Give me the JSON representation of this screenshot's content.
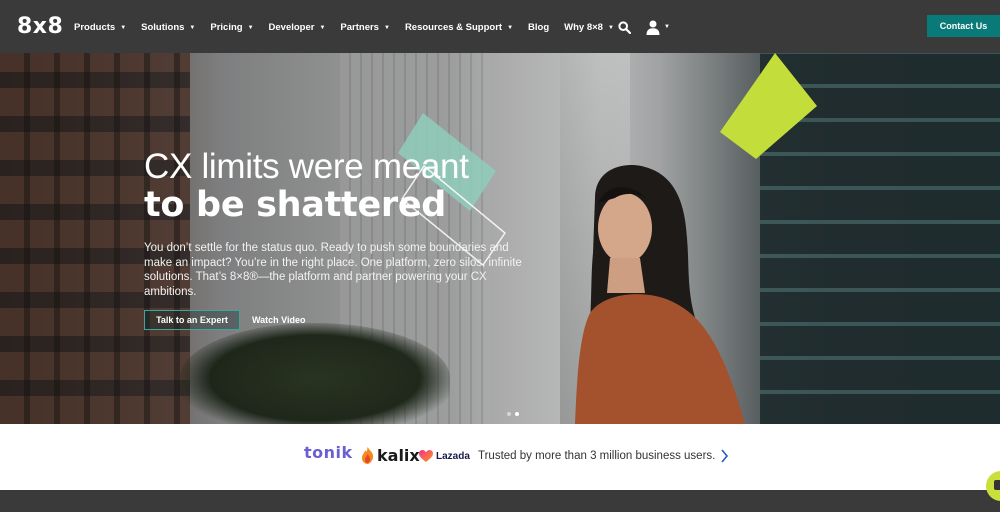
{
  "nav": {
    "logo": "8x8",
    "menu": [
      {
        "label": "Products",
        "caret": "▼"
      },
      {
        "label": "Solutions",
        "caret": "▼"
      },
      {
        "label": "Pricing",
        "caret": "▼"
      },
      {
        "label": "Developer",
        "caret": "▼"
      },
      {
        "label": "Partners",
        "caret": "▼"
      },
      {
        "label": "Resources & Support",
        "caret": "▼"
      },
      {
        "label": "Blog",
        "caret": ""
      },
      {
        "label": "Why 8×8",
        "caret": "▼"
      }
    ],
    "icons": {
      "search": "search-icon",
      "user": "user-icon"
    },
    "user_caret": "▼",
    "contact_label": "Contact Us"
  },
  "hero": {
    "headline_line1": "CX limits were meant",
    "headline_line2": "to be shattered",
    "subtext": "You don’t settle for the status quo. Ready to push some boundaries and make an impact? You’re in the right place. One platform, zero silos, infinite solutions. That’s 8×8®—the platform and partner powering your CX ambitions.",
    "cta_primary": "Talk to an Expert",
    "cta_secondary": "Watch Video",
    "slide_count": 2,
    "active_slide": 2
  },
  "trust": {
    "logos": [
      "tonik",
      "kalix",
      "Lazada"
    ],
    "text": "Trusted by more than 3 million business users.",
    "arrow_icon": "chevron-right-icon"
  },
  "colors": {
    "nav_bg": "#3a3a3a",
    "accent_teal": "#0a7a78",
    "accent_lime": "#c9df3c",
    "tonik_purple": "#6b5fd4"
  }
}
